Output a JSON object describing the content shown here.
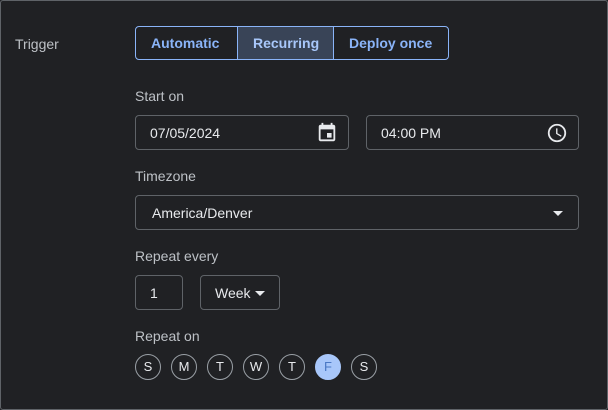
{
  "trigger": {
    "label": "Trigger",
    "options": [
      {
        "label": "Automatic",
        "selected": false
      },
      {
        "label": "Recurring",
        "selected": true
      },
      {
        "label": "Deploy once",
        "selected": false
      }
    ]
  },
  "start_on": {
    "label": "Start on",
    "date_value": "07/05/2024",
    "date_icon": "calendar-icon",
    "time_value": "04:00 PM",
    "time_icon": "clock-icon"
  },
  "timezone": {
    "label": "Timezone",
    "value": "America/Denver"
  },
  "repeat_every": {
    "label": "Repeat every",
    "count": "1",
    "unit": "Week"
  },
  "repeat_on": {
    "label": "Repeat on",
    "days": [
      {
        "label": "S",
        "selected": false
      },
      {
        "label": "M",
        "selected": false
      },
      {
        "label": "T",
        "selected": false
      },
      {
        "label": "W",
        "selected": false
      },
      {
        "label": "T",
        "selected": false
      },
      {
        "label": "F",
        "selected": true
      },
      {
        "label": "S",
        "selected": false
      }
    ]
  },
  "colors": {
    "background": "#202124",
    "accent": "#8ab4f8",
    "selected_fill": "#a8c7fa"
  }
}
